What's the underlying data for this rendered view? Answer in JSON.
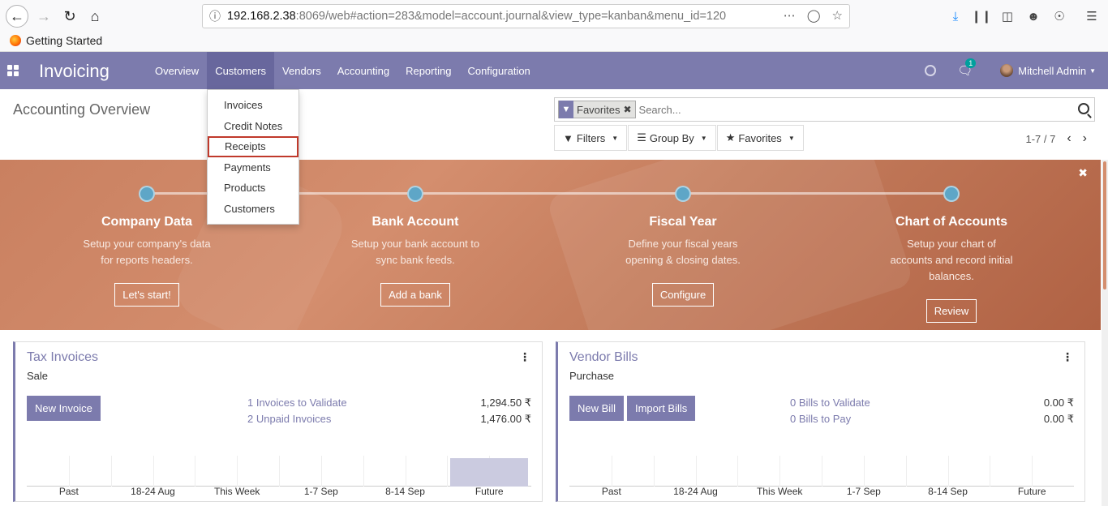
{
  "browser": {
    "url_host": "192.168.2.38",
    "url_rest": ":8069/web#action=283&model=account.journal&view_type=kanban&menu_id=120",
    "bookmark": "Getting Started"
  },
  "navbar": {
    "brand": "Invoicing",
    "menu": [
      "Overview",
      "Customers",
      "Vendors",
      "Accounting",
      "Reporting",
      "Configuration"
    ],
    "chat_badge": "1",
    "user": "Mitchell Admin",
    "accent": "#7c7bad"
  },
  "dropdown": {
    "items": [
      "Invoices",
      "Credit Notes",
      "Receipts",
      "Payments",
      "Products",
      "Customers"
    ],
    "highlighted": "Receipts"
  },
  "control_panel": {
    "breadcrumb": "Accounting Overview",
    "facet": "Favorites",
    "search_placeholder": "Search...",
    "filters": "Filters",
    "group_by": "Group By",
    "favorites": "Favorites",
    "pager": "1-7 / 7"
  },
  "banner": {
    "steps": [
      {
        "title": "Company Data",
        "desc": "Setup your company's data for reports headers.",
        "button": "Let's start!"
      },
      {
        "title": "Bank Account",
        "desc": "Setup your bank account to sync bank feeds.",
        "button": "Add a bank"
      },
      {
        "title": "Fiscal Year",
        "desc": "Define your fiscal years opening & closing dates.",
        "button": "Configure"
      },
      {
        "title": "Chart of Accounts",
        "desc": "Setup your chart of accounts and record initial balances.",
        "button": "Review"
      }
    ]
  },
  "cards": [
    {
      "title": "Tax Invoices",
      "subtitle": "Sale",
      "buttons": [
        "New Invoice"
      ],
      "stats": [
        {
          "label": "1 Invoices to Validate",
          "value": "1,294.50 ₹"
        },
        {
          "label": "2 Unpaid Invoices",
          "value": "1,476.00 ₹"
        }
      ]
    },
    {
      "title": "Vendor Bills",
      "subtitle": "Purchase",
      "buttons": [
        "New Bill",
        "Import Bills"
      ],
      "stats": [
        {
          "label": "0 Bills to Validate",
          "value": "0.00 ₹"
        },
        {
          "label": "0 Bills to Pay",
          "value": "0.00 ₹"
        }
      ]
    }
  ],
  "chart_data": [
    {
      "type": "bar",
      "categories": [
        "Past",
        "18-24 Aug",
        "This Week",
        "1-7 Sep",
        "8-14 Sep",
        "Future"
      ],
      "values": [
        0,
        0,
        0,
        0,
        0,
        1
      ],
      "title": "",
      "xlabel": "",
      "ylabel": ""
    },
    {
      "type": "bar",
      "categories": [
        "Past",
        "18-24 Aug",
        "This Week",
        "1-7 Sep",
        "8-14 Sep",
        "Future"
      ],
      "values": [
        0,
        0,
        0,
        0,
        0,
        0
      ],
      "title": "",
      "xlabel": "",
      "ylabel": ""
    }
  ]
}
